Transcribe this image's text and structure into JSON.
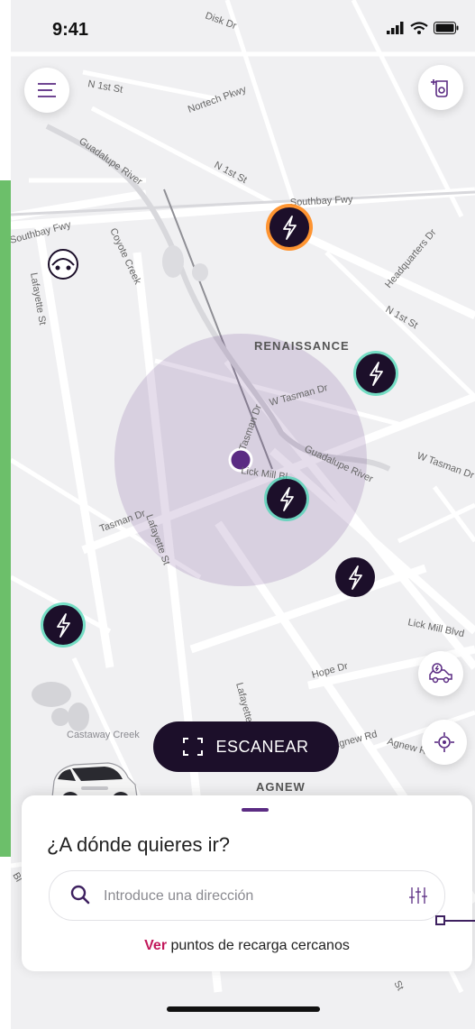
{
  "status_bar": {
    "time": "9:41"
  },
  "map": {
    "streets": [
      "Disk Dr",
      "N 1st St",
      "Nortech Pkwy",
      "Guadalupe River",
      "N 1st St",
      "Southbay Fwy",
      "Southbay Fwy",
      "Coyote Creek",
      "Lafayette St",
      "Headquarters Dr",
      "N 1st St",
      "W Tasman Dr",
      "Tasman Dr",
      "Lick Mill Bl",
      "Guadalupe River",
      "W Tasman Dr",
      "Tasman Dr",
      "Lafayette St",
      "Lick Mill Blvd",
      "Hope Dr",
      "Lafayette St",
      "Agnew Rd",
      "Agnew Rd",
      "Castaway Creek",
      "Bl",
      "St"
    ],
    "areas": [
      "RENAISSANCE",
      "AGNEW"
    ]
  },
  "scan_button": {
    "label": "ESCANEAR"
  },
  "sheet": {
    "title": "¿A dónde quieres ir?",
    "search_placeholder": "Introduce una dirección",
    "nearby_link": "Ver",
    "nearby_text": " puntos de recarga cercanos"
  },
  "icons": {
    "menu": "menu-icon",
    "top_right": "charger-plug-icon",
    "vehicle": "car-charging-icon",
    "locate": "locate-icon",
    "search": "search-icon",
    "filter": "filter-icon"
  },
  "colors": {
    "brand_dark": "#1c0f2a",
    "accent_purple": "#5b2c83",
    "link_magenta": "#c2185b",
    "marker_glow": "#3fd4b0",
    "marker_selected_glow": "#ff8a1c"
  }
}
